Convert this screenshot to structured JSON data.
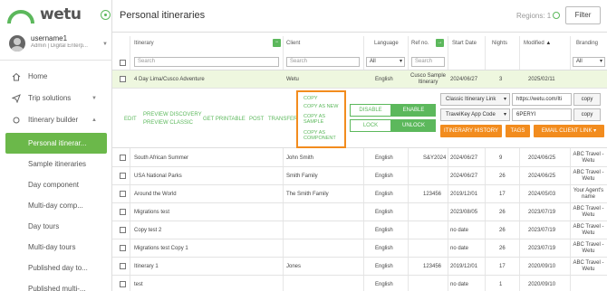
{
  "app": {
    "logo_text": "wetu"
  },
  "user": {
    "name": "username1",
    "role": "Admin | Digital Enterp..."
  },
  "nav": {
    "home": "Home",
    "trip_solutions": "Trip solutions",
    "itinerary_builder": "Itinerary builder",
    "sub_items": [
      "Personal itinerar...",
      "Sample itineraries",
      "Day component",
      "Multi-day comp...",
      "Day tours",
      "Multi-day tours",
      "Published day to...",
      "Published multi-..."
    ]
  },
  "header": {
    "title": "Personal itineraries",
    "regions": "Regions: 1",
    "filter": "Filter"
  },
  "columns": {
    "itinerary": "Itinerary",
    "client": "Client",
    "language": "Language",
    "ref": "Ref no.",
    "start_date": "Start Date",
    "nights": "Nights",
    "modified": "Modified",
    "branding": "Branding",
    "search_placeholder": "Search",
    "all": "All"
  },
  "selected_row": {
    "itinerary": "4 Day Lima/Cusco Adventure",
    "client": "Wetu",
    "language": "English",
    "ref": "Cusco Sample Itinerary",
    "start_date": "2024/06/27",
    "nights": "3",
    "modified": "2025/02/11"
  },
  "actions": {
    "edit": "EDIT",
    "preview_discovery": "PREVIEW DISCOVERY",
    "preview_classic": "PREVIEW CLASSIC",
    "get_printable": "GET PRINTABLE",
    "post": "POST",
    "transfer": "TRANSFER",
    "copy_menu": [
      "COPY",
      "COPY AS NEW",
      "COPY AS SAMPLE",
      "COPY AS COMPONENT"
    ],
    "disable": "DISABLE",
    "enable": "ENABLE",
    "lock": "LOCK",
    "unlock": "UNLOCK",
    "link_type": "Classic Itinerary Link",
    "link_value": "https://wetu.com/Iti",
    "copy": "copy",
    "app_code_type": "TravelKey App Code",
    "app_code_value": "6PERYI",
    "itinerary_history": "ITINERARY HISTORY",
    "tags": "TAGS",
    "email_client_link": "EMAIL CLIENT LINK"
  },
  "rows": [
    {
      "itinerary": "South African Summer",
      "client": "John Smith",
      "language": "English",
      "ref": "S&Y2024",
      "start_date": "2024/06/27",
      "nights": "9",
      "modified": "2024/06/25",
      "branding": "ABC Travel - Wetu"
    },
    {
      "itinerary": "USA National Parks",
      "client": "Smith Family",
      "language": "English",
      "ref": "",
      "start_date": "2024/06/27",
      "nights": "26",
      "modified": "2024/06/25",
      "branding": "ABC Travel - Wetu"
    },
    {
      "itinerary": "Around the World",
      "client": "The Smith Family",
      "language": "English",
      "ref": "123456",
      "start_date": "2019/12/01",
      "nights": "17",
      "modified": "2024/05/03",
      "branding": "Your Agent's name"
    },
    {
      "itinerary": "Migrations test",
      "client": "",
      "language": "English",
      "ref": "",
      "start_date": "2023/08/05",
      "nights": "26",
      "modified": "2023/07/19",
      "branding": "ABC Travel - Wetu"
    },
    {
      "itinerary": "Copy test 2",
      "client": "",
      "language": "English",
      "ref": "",
      "start_date": "no date",
      "nights": "26",
      "modified": "2023/07/19",
      "branding": "ABC Travel - Wetu"
    },
    {
      "itinerary": "Migrations test Copy 1",
      "client": "",
      "language": "English",
      "ref": "",
      "start_date": "no date",
      "nights": "26",
      "modified": "2023/07/19",
      "branding": "ABC Travel - Wetu"
    },
    {
      "itinerary": "Itinerary 1",
      "client": "Jones",
      "language": "English",
      "ref": "123456",
      "start_date": "2019/12/01",
      "nights": "17",
      "modified": "2020/09/10",
      "branding": "ABC Travel - Wetu"
    },
    {
      "itinerary": "test",
      "client": "",
      "language": "English",
      "ref": "",
      "start_date": "no date",
      "nights": "1",
      "modified": "2020/09/10",
      "branding": ""
    }
  ],
  "colors": {
    "brand_green": "#5cb85c",
    "active_green": "#6bb84a",
    "orange": "#f28c1e",
    "highlight_row": "#eef7df"
  }
}
